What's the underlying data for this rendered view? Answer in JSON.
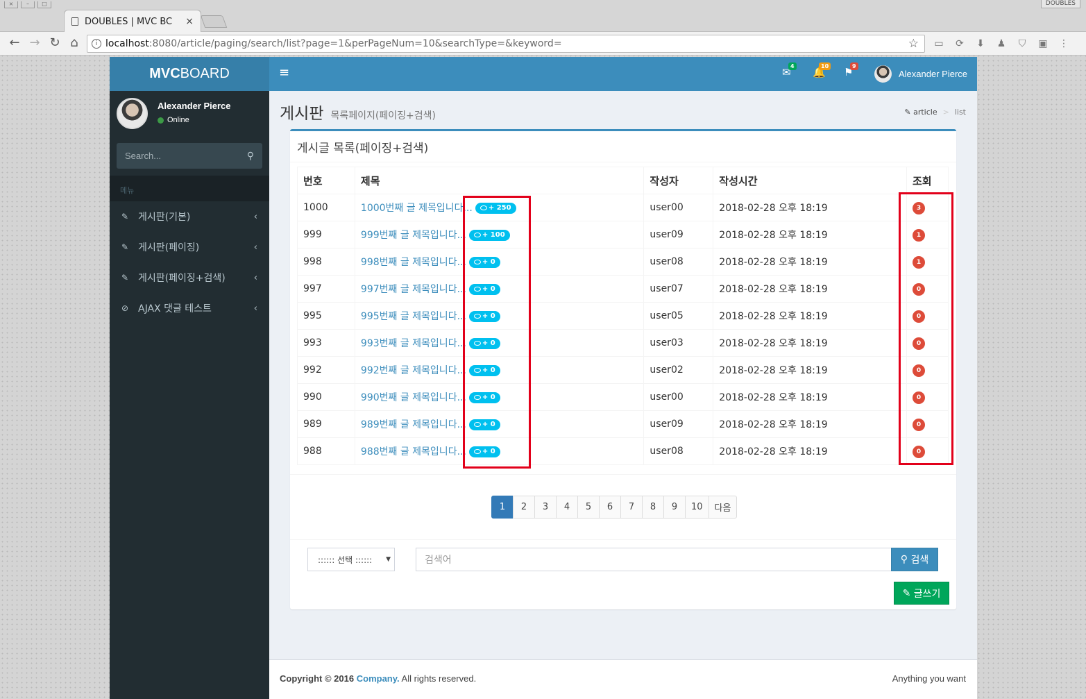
{
  "browser": {
    "tab_title": "DOUBLES | MVC BC",
    "tab_close": "×",
    "url_host": "localhost",
    "url_rest": ":8080/article/paging/search/list?page=1&perPageNum=10&searchType=&keyword=",
    "profile": "DOUBLES"
  },
  "app": {
    "logo_bold": "MVC",
    "logo_rest": "BOARD",
    "user_name": "Alexander Pierce",
    "user_status": "Online",
    "sidebar_search_placeholder": "Search...",
    "menu_header": "메뉴",
    "menu": [
      {
        "label": "게시판(기본)",
        "icon": "edit-icon"
      },
      {
        "label": "게시판(페이징)",
        "icon": "edit-icon"
      },
      {
        "label": "게시판(페이징+검색)",
        "icon": "edit-icon"
      },
      {
        "label": "AJAX 댓글 테스트",
        "icon": "check-circle-icon"
      }
    ],
    "notifications": {
      "messages": "4",
      "alerts": "10",
      "tasks": "9"
    }
  },
  "content": {
    "title": "게시판",
    "subtitle": "목록페이지(페이징+검색)",
    "breadcrumb": [
      "article",
      "list"
    ],
    "box_title": "게시글 목록(페이징+검색)",
    "columns": [
      "번호",
      "제목",
      "작성자",
      "작성시간",
      "조회"
    ],
    "rows": [
      {
        "no": "1000",
        "title": "1000번째 글 제목입니다...",
        "replies": "+ 250",
        "writer": "user00",
        "time": "2018-02-28 오후 18:19",
        "views": "3"
      },
      {
        "no": "999",
        "title": "999번째 글 제목입니다...",
        "replies": "+ 100",
        "writer": "user09",
        "time": "2018-02-28 오후 18:19",
        "views": "1"
      },
      {
        "no": "998",
        "title": "998번째 글 제목입니다...",
        "replies": "+ 0",
        "writer": "user08",
        "time": "2018-02-28 오후 18:19",
        "views": "1"
      },
      {
        "no": "997",
        "title": "997번째 글 제목입니다...",
        "replies": "+ 0",
        "writer": "user07",
        "time": "2018-02-28 오후 18:19",
        "views": "0"
      },
      {
        "no": "995",
        "title": "995번째 글 제목입니다...",
        "replies": "+ 0",
        "writer": "user05",
        "time": "2018-02-28 오후 18:19",
        "views": "0"
      },
      {
        "no": "993",
        "title": "993번째 글 제목입니다...",
        "replies": "+ 0",
        "writer": "user03",
        "time": "2018-02-28 오후 18:19",
        "views": "0"
      },
      {
        "no": "992",
        "title": "992번째 글 제목입니다...",
        "replies": "+ 0",
        "writer": "user02",
        "time": "2018-02-28 오후 18:19",
        "views": "0"
      },
      {
        "no": "990",
        "title": "990번째 글 제목입니다...",
        "replies": "+ 0",
        "writer": "user00",
        "time": "2018-02-28 오후 18:19",
        "views": "0"
      },
      {
        "no": "989",
        "title": "989번째 글 제목입니다...",
        "replies": "+ 0",
        "writer": "user09",
        "time": "2018-02-28 오후 18:19",
        "views": "0"
      },
      {
        "no": "988",
        "title": "988번째 글 제목입니다...",
        "replies": "+ 0",
        "writer": "user08",
        "time": "2018-02-28 오후 18:19",
        "views": "0"
      }
    ],
    "pages": [
      "1",
      "2",
      "3",
      "4",
      "5",
      "6",
      "7",
      "8",
      "9",
      "10",
      "다음"
    ],
    "active_page": "1",
    "search_type": ":::::: 선택 ::::::",
    "search_placeholder": "검색어",
    "search_button": "검색",
    "write_button": "글쓰기"
  },
  "footer": {
    "copyright": "Copyright © 2016",
    "company": "Company.",
    "rights": "All rights reserved.",
    "right_text": "Anything you want"
  },
  "colors": {
    "brand": "#3c8dbc",
    "sidebar": "#222d32",
    "reply_badge": "#00c0ef",
    "view_badge": "#dd4b39",
    "highlight": "#e2001a",
    "write_button": "#00a65a"
  }
}
